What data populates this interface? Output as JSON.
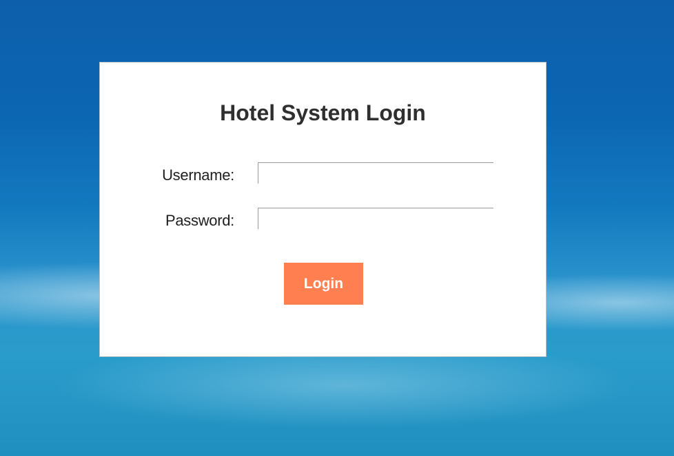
{
  "login": {
    "title": "Hotel System Login",
    "username_label": "Username:",
    "password_label": "Password:",
    "username_value": "",
    "password_value": "",
    "button_label": "Login"
  },
  "colors": {
    "button_background": "#ff7f50",
    "card_background": "#ffffff",
    "title_text": "#2f2f2f",
    "background_sky": "#0c66b2"
  }
}
